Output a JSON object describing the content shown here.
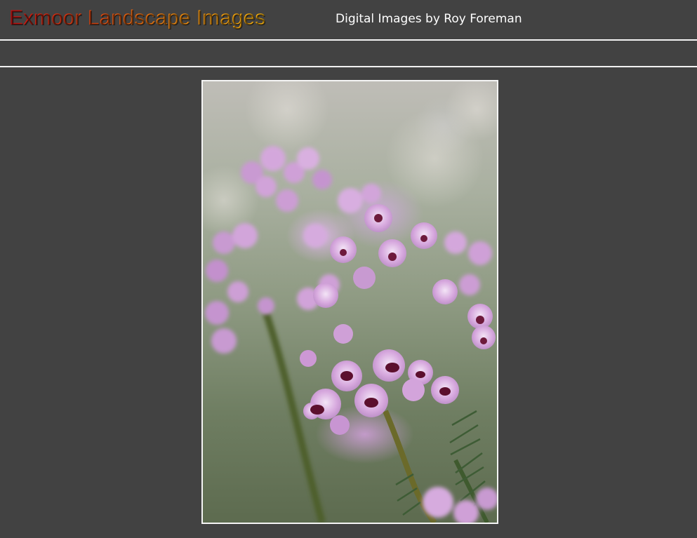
{
  "header": {
    "title": "Exmoor Landscape Images",
    "subtitle": "Digital Images by Roy Foreman"
  },
  "photo": {
    "subject": "heather-flower-photo"
  },
  "colors": {
    "background": "#424242",
    "rule": "#f2f2f2",
    "title_gradient_start": "#d01010",
    "title_gradient_end": "#f7b30f",
    "subtitle": "#ffffff"
  }
}
